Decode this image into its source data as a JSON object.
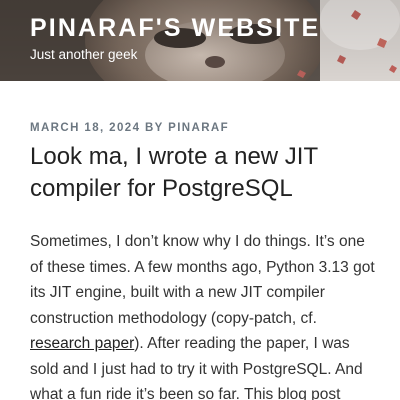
{
  "site": {
    "title": "PINARAF'S WEBSITE",
    "description": "Just another geek"
  },
  "post": {
    "date": "MARCH 18, 2024",
    "by": "BY",
    "author": "PINARAF",
    "title": "Look ma, I wrote a new JIT compiler for PostgreSQL",
    "excerpt": {
      "before_link": "Sometimes, I don’t know why I do things. It’s one of these times. A few months ago, Python 3.13 got its JIT engine, built with a new JIT compiler construction methodology (copy-patch, cf. ",
      "link_text": "research paper",
      "after_link": "). After reading the paper, I was sold and I just had to try it with PostgreSQL. And what a fun ride it’s been so far. This blog post"
    }
  },
  "colors": {
    "meta": "#6c7781",
    "title_text": "#222222",
    "header_text": "#ffffff"
  },
  "header_image": "cat-photo"
}
